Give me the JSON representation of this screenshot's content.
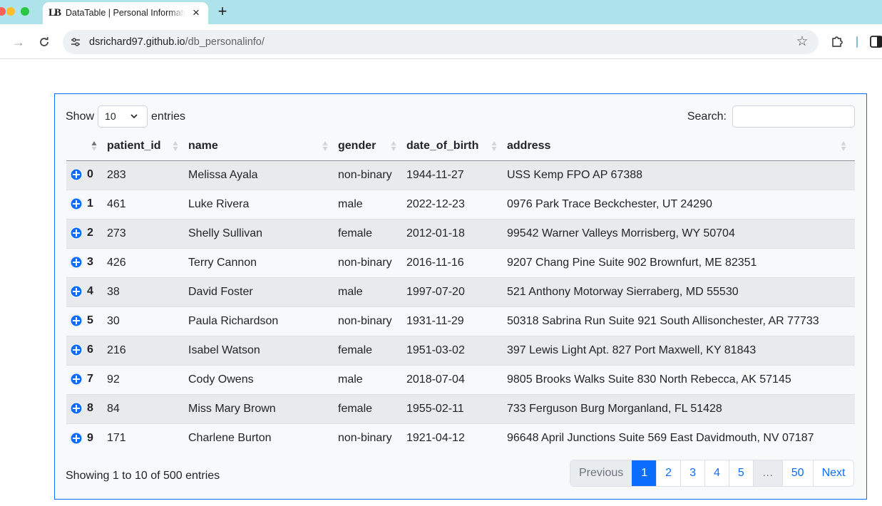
{
  "browser": {
    "tab_title": "DataTable | Personal Information",
    "url_host": "dsrichard97.github.io",
    "url_path": "/db_personalinfo/"
  },
  "table_controls": {
    "show_label": "Show",
    "length_value": "10",
    "entries_label": "entries",
    "search_label": "Search:",
    "search_value": ""
  },
  "columns": [
    "",
    "patient_id",
    "name",
    "gender",
    "date_of_birth",
    "address"
  ],
  "rows": [
    {
      "index": "0",
      "patient_id": "283",
      "name": "Melissa Ayala",
      "gender": "non-binary",
      "date_of_birth": "1944-11-27",
      "address": "USS Kemp FPO AP 67388"
    },
    {
      "index": "1",
      "patient_id": "461",
      "name": "Luke Rivera",
      "gender": "male",
      "date_of_birth": "2022-12-23",
      "address": "0976 Park Trace Beckchester, UT 24290"
    },
    {
      "index": "2",
      "patient_id": "273",
      "name": "Shelly Sullivan",
      "gender": "female",
      "date_of_birth": "2012-01-18",
      "address": "99542 Warner Valleys Morrisberg, WY 50704"
    },
    {
      "index": "3",
      "patient_id": "426",
      "name": "Terry Cannon",
      "gender": "non-binary",
      "date_of_birth": "2016-11-16",
      "address": "9207 Chang Pine Suite 902 Brownfurt, ME 82351"
    },
    {
      "index": "4",
      "patient_id": "38",
      "name": "David Foster",
      "gender": "male",
      "date_of_birth": "1997-07-20",
      "address": "521 Anthony Motorway Sierraberg, MD 55530"
    },
    {
      "index": "5",
      "patient_id": "30",
      "name": "Paula Richardson",
      "gender": "non-binary",
      "date_of_birth": "1931-11-29",
      "address": "50318 Sabrina Run Suite 921 South Allisonchester, AR 77733"
    },
    {
      "index": "6",
      "patient_id": "216",
      "name": "Isabel Watson",
      "gender": "female",
      "date_of_birth": "1951-03-02",
      "address": "397 Lewis Light Apt. 827 Port Maxwell, KY 81843"
    },
    {
      "index": "7",
      "patient_id": "92",
      "name": "Cody Owens",
      "gender": "male",
      "date_of_birth": "2018-07-04",
      "address": "9805 Brooks Walks Suite 830 North Rebecca, AK 57145"
    },
    {
      "index": "8",
      "patient_id": "84",
      "name": "Miss Mary Brown",
      "gender": "female",
      "date_of_birth": "1955-02-11",
      "address": "733 Ferguson Burg Morganland, FL 51428"
    },
    {
      "index": "9",
      "patient_id": "171",
      "name": "Charlene Burton",
      "gender": "non-binary",
      "date_of_birth": "1921-04-12",
      "address": "96648 April Junctions Suite 569 East Davidmouth, NV 07187"
    }
  ],
  "info_text": "Showing 1 to 10 of 500 entries",
  "pagination": {
    "previous": "Previous",
    "pages": [
      "1",
      "2",
      "3",
      "4",
      "5"
    ],
    "active_page": "1",
    "ellipsis": "…",
    "last": "50",
    "next": "Next"
  },
  "colors": {
    "accent": "#0d6efd",
    "tab_strip": "#aee3ec"
  }
}
